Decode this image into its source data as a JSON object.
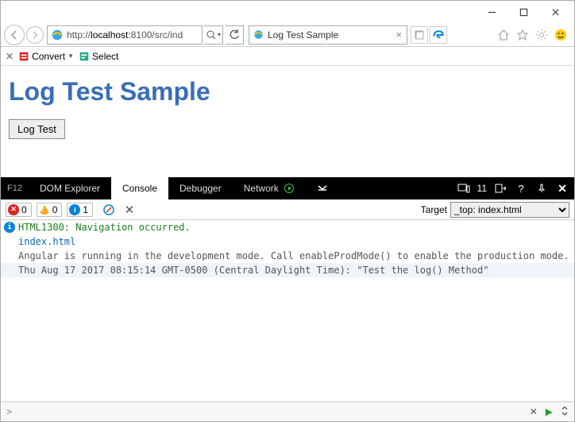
{
  "titlebar": {
    "minimize": "Minimize",
    "maximize": "Maximize",
    "close": "Close"
  },
  "navbar": {
    "url_prefix": "http://",
    "url_host": "localhost",
    "url_rest": ":8100/src/ind",
    "tab_title": "Log Test Sample"
  },
  "toolbar2": {
    "convert_label": "Convert",
    "select_label": "Select"
  },
  "page": {
    "heading": "Log Test Sample",
    "button_label": "Log Test"
  },
  "devtools": {
    "f12": "F12",
    "tabs": {
      "dom": "DOM Explorer",
      "console": "Console",
      "debugger": "Debugger",
      "network": "Network"
    },
    "error_badge": "11"
  },
  "console_toolbar": {
    "errors": "0",
    "warnings": "0",
    "info": "1",
    "target_label": "Target",
    "target_value": "_top: index.html"
  },
  "console": {
    "rows": [
      {
        "type": "nav",
        "code": "HTML1300:",
        "msg": "Navigation occurred."
      },
      {
        "type": "file",
        "text": "index.html"
      },
      {
        "type": "plain",
        "text": "Angular is running in the development mode. Call enableProdMode() to enable the production mode."
      },
      {
        "type": "highlight",
        "text": "Thu Aug 17 2017 08:15:14 GMT-0500 (Central Daylight Time): \"Test the log() Method\""
      }
    ]
  }
}
